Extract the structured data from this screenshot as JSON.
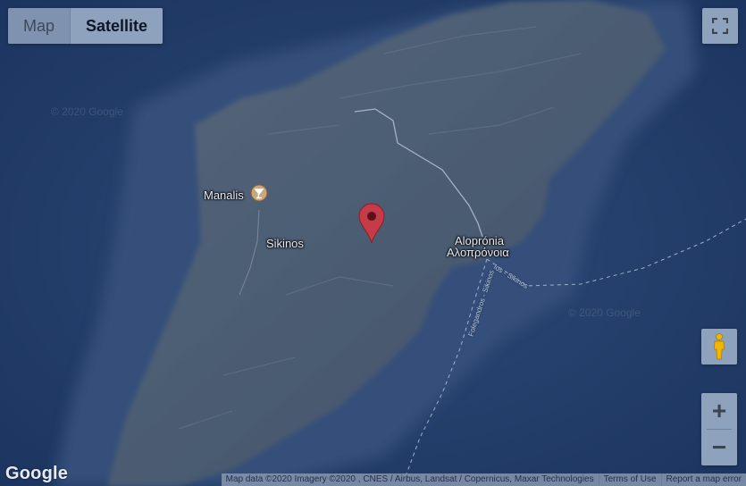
{
  "map_type": {
    "options": [
      "Map",
      "Satellite"
    ],
    "selected": "Satellite"
  },
  "labels": {
    "manalis": "Manalis",
    "sikinos": "Sikinos",
    "alopronia_latin": "Aloprónia",
    "alopronia_greek": "Αλοπρόνοια",
    "route_1": "Folegandros - Sikinos",
    "route_2": "Ios - Sikinos"
  },
  "watermarks": [
    "© 2020 Google",
    "© 2020 Google"
  ],
  "zoom": {
    "in": "+",
    "out": "−"
  },
  "footer": {
    "map_data": "Map data ©2020 Imagery ©2020 , CNES / Airbus, Landsat / Copernicus, Maxar Technologies",
    "terms": "Terms of Use",
    "report": "Report a map error"
  },
  "logo": "Google",
  "colors": {
    "sea": "#1f3a66",
    "land": "#4b5d73",
    "marker": "#c53b48",
    "poi": "#c9a77e"
  }
}
